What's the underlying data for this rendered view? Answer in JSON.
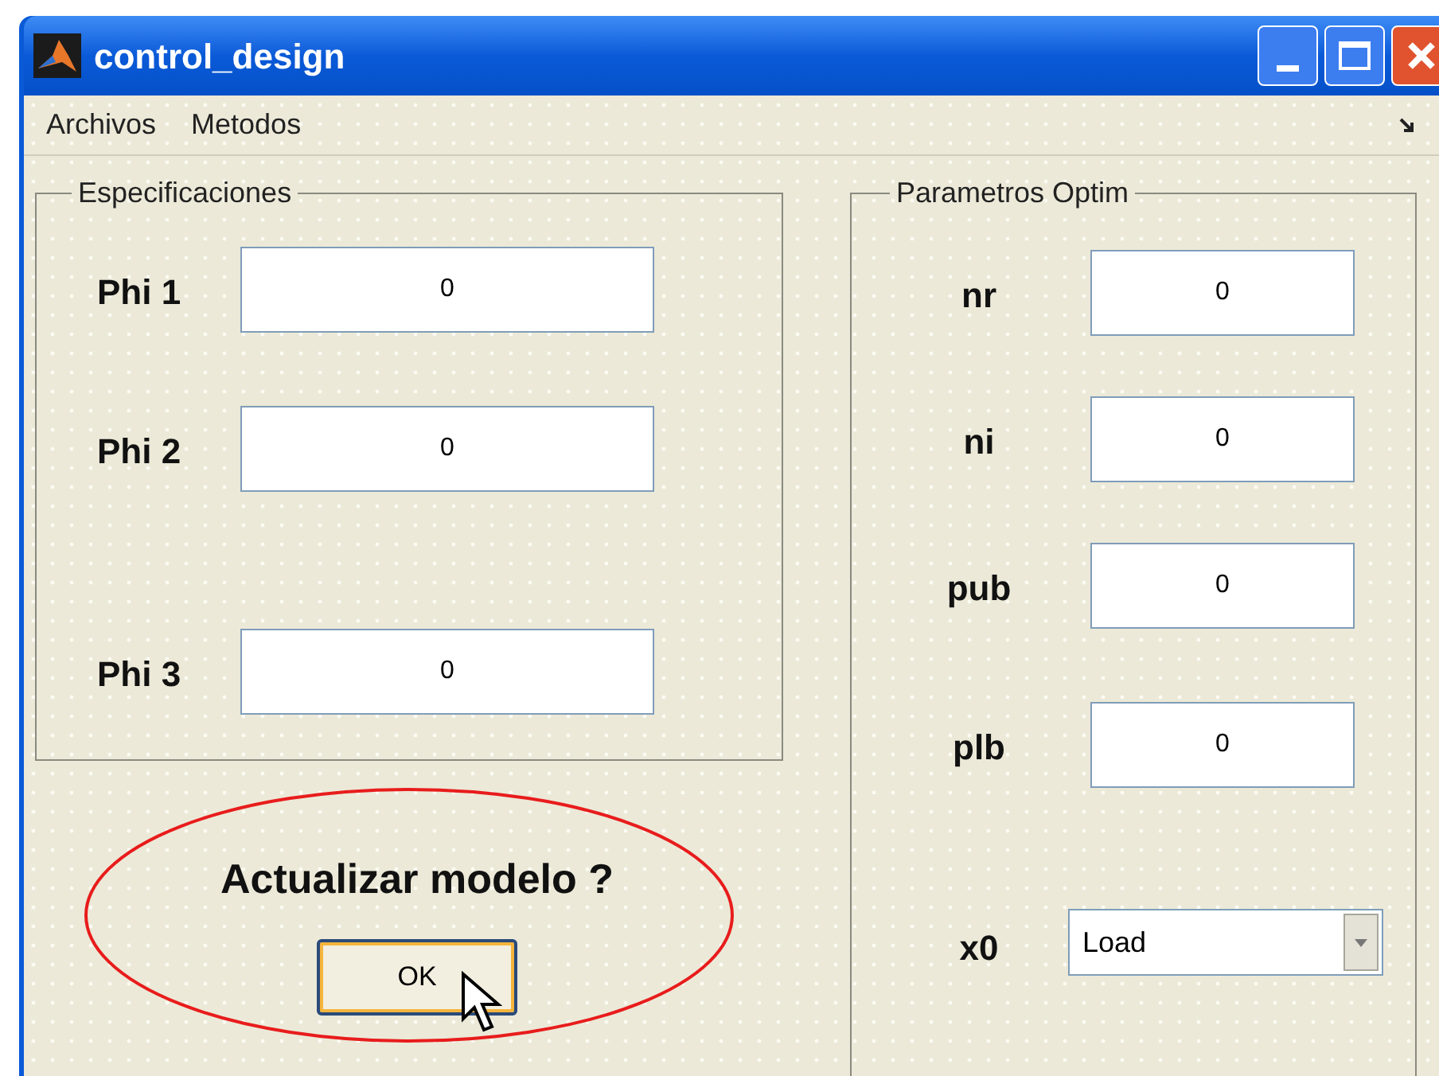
{
  "window": {
    "title": "control_design"
  },
  "menu": [
    "Archivos",
    "Metodos"
  ],
  "especificaciones": {
    "title": "Especificaciones",
    "fields": [
      {
        "label": "Phi 1",
        "value": "0"
      },
      {
        "label": "Phi 2",
        "value": "0"
      },
      {
        "label": "Phi 3",
        "value": "0"
      }
    ]
  },
  "prompt": {
    "text": "Actualizar modelo ?",
    "button": "OK"
  },
  "parametros": {
    "title": "Parametros Optim",
    "fields": [
      {
        "kind": "edit",
        "label": "nr",
        "value": "0"
      },
      {
        "kind": "edit",
        "label": "ni",
        "value": "0"
      },
      {
        "kind": "edit",
        "label": "pub",
        "value": "0"
      },
      {
        "kind": "edit",
        "label": "plb",
        "value": "0"
      },
      {
        "kind": "popup",
        "label": "x0",
        "value": "Load"
      }
    ]
  }
}
